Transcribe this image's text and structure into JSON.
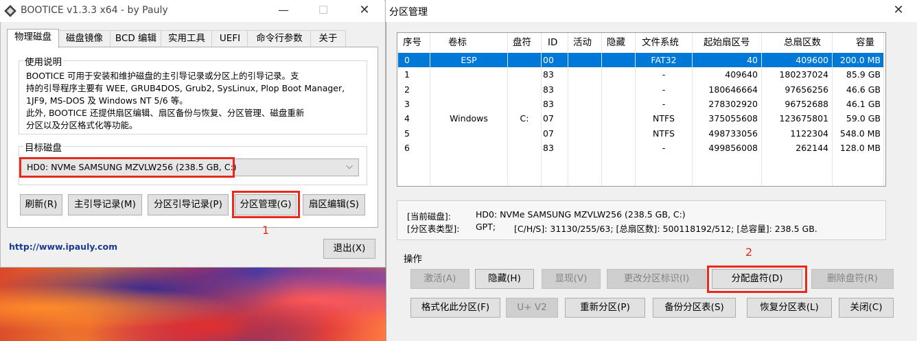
{
  "left_window": {
    "title": "BOOTICE v1.3.3 x64 - by Pauly",
    "tabs": [
      "物理磁盘",
      "磁盘镜像",
      "BCD 编辑",
      "实用工具",
      "UEFI",
      "命令行参数",
      "关于"
    ],
    "usage_group": {
      "label": "使用说明",
      "lines": [
        "BOOTICE 可用于安装和维护磁盘的主引导记录或分区上的引导记录。支",
        "持的引导程序主要有 WEE, GRUB4DOS, Grub2, SysLinux, Plop Boot Manager,",
        "1JF9, MS-DOS 及 Windows NT 5/6 等。",
        "此外, BOOTICE 还提供扇区编辑、扇区备份与恢复、分区管理、磁盘重新",
        "分区以及分区格式化等功能。"
      ]
    },
    "target_group": {
      "label": "目标磁盘",
      "selected_disk": "HD0: NVMe SAMSUNG MZVLW256 (238.5 GB, C:)"
    },
    "buttons": {
      "refresh": "刷新(R)",
      "mbr": "主引导记录(M)",
      "pbr": "分区引导记录(P)",
      "partition_mgmt": "分区管理(G)",
      "sector_edit": "扇区编辑(S)",
      "exit": "退出(X)"
    },
    "marker_1": "1",
    "link": "http://www.ipauly.com"
  },
  "right_window": {
    "title": "分区管理",
    "columns": [
      "序号",
      "卷标",
      "盘符",
      "ID",
      "活动",
      "隐藏",
      "文件系统",
      "起始扇区号",
      "总扇区数",
      "容量"
    ],
    "rows": [
      {
        "idx": "0",
        "label": "ESP",
        "letter": "",
        "id": "00",
        "active": "",
        "hidden": "",
        "fs": "FAT32",
        "start": "40",
        "total": "409600",
        "size": "200.0 MB"
      },
      {
        "idx": "1",
        "label": "",
        "letter": "",
        "id": "83",
        "active": "",
        "hidden": "",
        "fs": "-",
        "start": "409640",
        "total": "180237024",
        "size": "85.9 GB"
      },
      {
        "idx": "2",
        "label": "",
        "letter": "",
        "id": "83",
        "active": "",
        "hidden": "",
        "fs": "-",
        "start": "180646664",
        "total": "97656256",
        "size": "46.6 GB"
      },
      {
        "idx": "3",
        "label": "",
        "letter": "",
        "id": "83",
        "active": "",
        "hidden": "",
        "fs": "-",
        "start": "278302920",
        "total": "96752688",
        "size": "46.1 GB"
      },
      {
        "idx": "4",
        "label": "Windows",
        "letter": "C:",
        "id": "07",
        "active": "",
        "hidden": "",
        "fs": "NTFS",
        "start": "375055608",
        "total": "123675801",
        "size": "59.0 GB"
      },
      {
        "idx": "5",
        "label": "",
        "letter": "",
        "id": "07",
        "active": "",
        "hidden": "",
        "fs": "NTFS",
        "start": "498733056",
        "total": "1122304",
        "size": "548.0 MB"
      },
      {
        "idx": "6",
        "label": "",
        "letter": "",
        "id": "83",
        "active": "",
        "hidden": "",
        "fs": "-",
        "start": "499856008",
        "total": "262144",
        "size": "128.0 MB"
      }
    ],
    "selected_row": 0,
    "info": {
      "current_disk_label": "[当前磁盘]:",
      "current_disk_value": "HD0: NVMe SAMSUNG MZVLW256 (238.5 GB, C:)",
      "table_type_label": "[分区表类型]:",
      "table_type_value": "GPT;",
      "geometry": "[C/H/S]: 31130/255/63; [总扇区数]: 500118192/512; [总容量]: 238.5 GB."
    },
    "ops_label": "操作",
    "marker_2": "2",
    "buttons_row1": {
      "activate": "激活(A)",
      "hide": "隐藏(H)",
      "show": "显现(V)",
      "change_id": "更改分区标识(I)",
      "assign_letter": "分配盘符(D)",
      "remove_letter": "删除盘符(R)"
    },
    "buttons_row2": {
      "format": "格式化此分区(F)",
      "uv2": "U+ V2",
      "repartition": "重新分区(P)",
      "backup": "备份分区表(S)",
      "restore": "恢复分区表(L)",
      "close": "关闭(C)"
    }
  },
  "colors": {
    "selection": "#0078d7",
    "highlight_box": "#e8291c",
    "link": "#1a3a8f"
  }
}
